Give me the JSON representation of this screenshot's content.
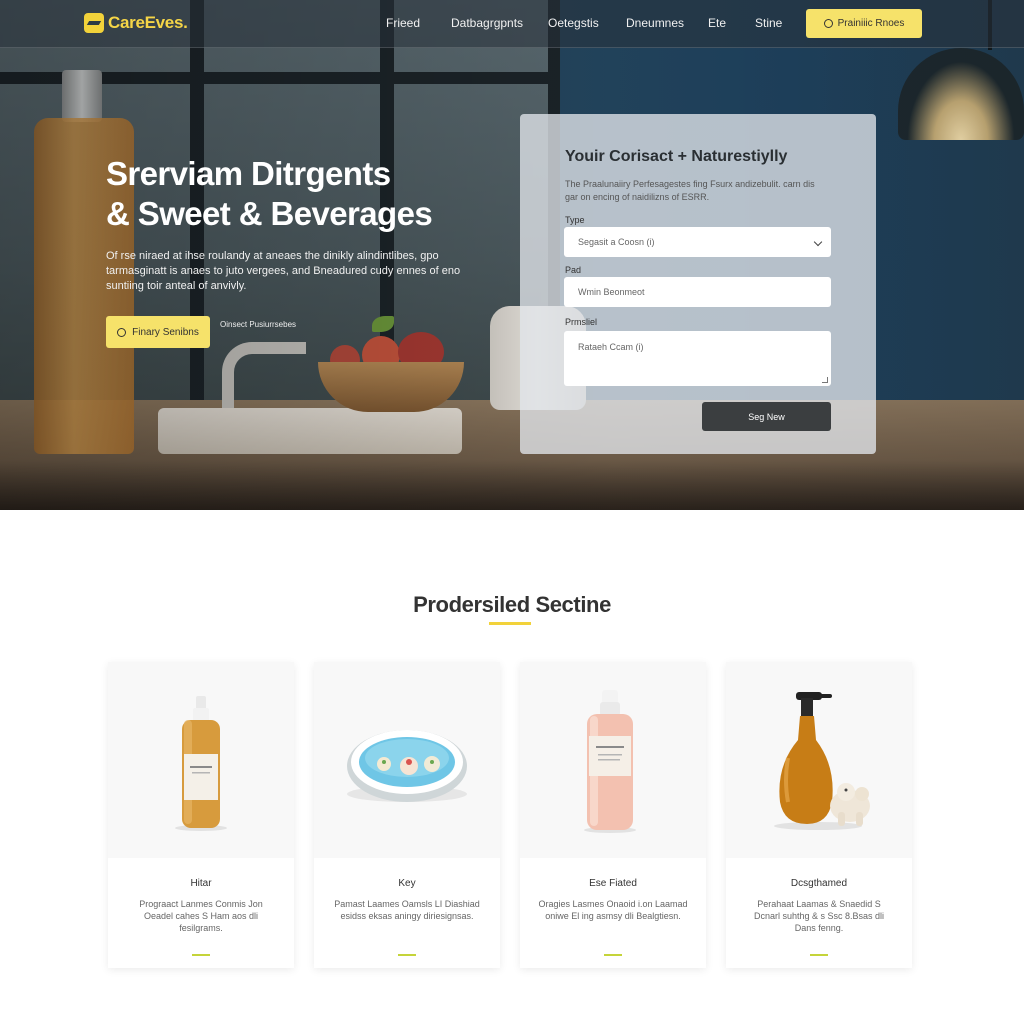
{
  "nav": {
    "logo": "CareEves.",
    "links": [
      "Frieed",
      "Datbagrgpnts",
      "Oetegstis",
      "Dneumnes",
      "Ete",
      "Stine"
    ],
    "cta": "Prainiiic Rnoes"
  },
  "hero": {
    "title_line1": "Srerviam Ditrgents",
    "title_line2": "& Sweet & Beverages",
    "description": "Of rse niraed at ihse roulandy at aneaes the dinikly alindintlibes, gpo tarmasginatt is anaes to juto vergees, and Bneadured cudy ennes of eno suntiing toir anteal of anvivly.",
    "button": "Finary Senibns",
    "sub_note": "Oinsect Pusiurrsebes"
  },
  "form": {
    "title": "Youir Corisact + Naturestiylly",
    "intro": "The Praalunaiiry Perfesagestes fing Fsurx andizebulit. carn dis gar on encing of naidilizns of ESRR.",
    "type_label": "Type",
    "type_value": "Segasit a Coosn (i)",
    "pad_label": "Pad",
    "pad_placeholder": "Wmin Beonmeot",
    "message_label": "Prmsliel",
    "message_placeholder": "Rataeh Ccam (i)",
    "submit": "Seg New"
  },
  "products": {
    "title": "Prodersiled Sectine",
    "items": [
      {
        "name": "Hitar",
        "description": "Prograact Lanmes Conmis Jon Oeadel cahes S Ham aos dli fesilgrams."
      },
      {
        "name": "Key",
        "description": "Pamast Laames Oamsls LI Diashiad esidss eksas aningy diriesignsas."
      },
      {
        "name": "Ese Fiated",
        "description": "Oragies Lasmes Onaoid i.on Laamad oniwe El ing asmsy dli Bealgtiesn."
      },
      {
        "name": "Dcsgthamed",
        "description": "Perahaat Laamas & Snaedid S Dcnarl suhthg & s Ssc 8.Bsas dli Dans fenng."
      }
    ]
  },
  "colors": {
    "accent_yellow": "#f6e26a",
    "logo_yellow": "#f5d547",
    "submit_dark": "#3b3e40",
    "card_bar": "#c5d43a"
  },
  "icons": [
    "logo-mark-icon",
    "circle-icon",
    "chevron-down-icon",
    "resize-grip-icon"
  ]
}
